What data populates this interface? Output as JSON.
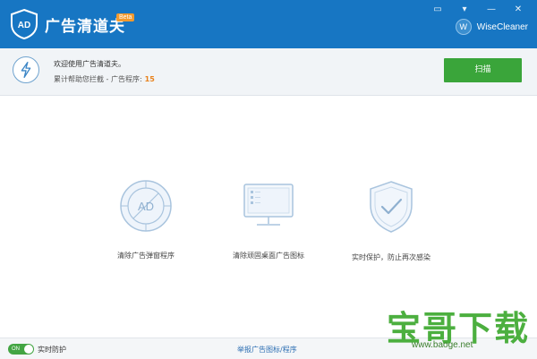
{
  "app": {
    "title": "广告清道夫",
    "beta": "Beta",
    "brand": "WiseCleaner",
    "brand_initial": "W"
  },
  "window_controls": [
    "▭",
    "▾",
    "—",
    "✕"
  ],
  "status": {
    "welcome": "欢迎使用广告清道夫。",
    "counter_label": "累计帮助您拦截 -   广告程序:",
    "counter_value": "15"
  },
  "scan_button": "扫描",
  "features": [
    {
      "label": "清除广告弹窗程序",
      "icon": "ad-block-icon"
    },
    {
      "label": "清除顽固桌面广告图标",
      "icon": "desktop-monitor-icon"
    },
    {
      "label": "实时保护，防止再次感染",
      "icon": "shield-check-icon"
    }
  ],
  "footer": {
    "toggle": "ON",
    "realtime_label": "实时防护",
    "report_link": "举报广告图标/程序"
  },
  "watermark": {
    "title": "宝哥下载",
    "url": "www.baoge.net"
  },
  "colors": {
    "title_bar": "#1776c3",
    "accent_green": "#3aa53a",
    "count_orange": "#e8811b",
    "link_blue": "#2d6fb3"
  }
}
